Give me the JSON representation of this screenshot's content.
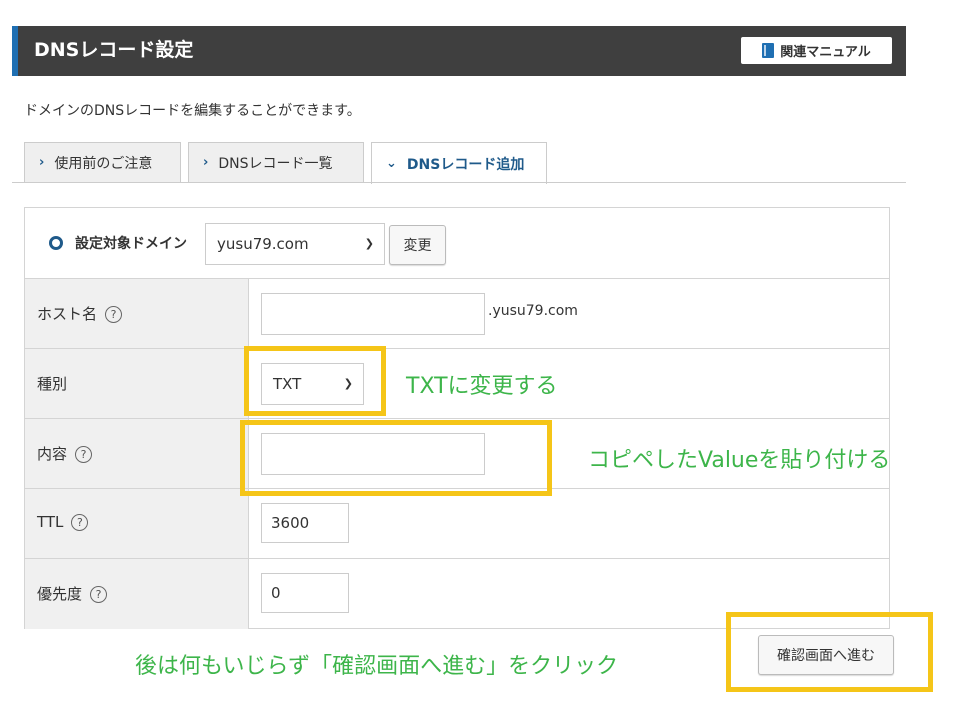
{
  "header": {
    "title": "DNSレコード設定",
    "manual_label": "関連マニュアル"
  },
  "description": "ドメインのDNSレコードを編集することができます。",
  "tabs": [
    {
      "label": "使用前のご注意",
      "chevron": "›",
      "active": false
    },
    {
      "label": "DNSレコード一覧",
      "chevron": "›",
      "active": false
    },
    {
      "label": "DNSレコード追加",
      "chevron": "⌄",
      "active": true
    }
  ],
  "domain": {
    "label": "設定対象ドメイン",
    "value": "yusu79.com",
    "change_label": "変更"
  },
  "form": {
    "host": {
      "label": "ホスト名",
      "value": "",
      "suffix": ".yusu79.com"
    },
    "type": {
      "label": "種別",
      "value": "TXT"
    },
    "content": {
      "label": "内容",
      "value": ""
    },
    "ttl": {
      "label": "TTL",
      "value": "3600"
    },
    "priority": {
      "label": "優先度",
      "value": "0"
    }
  },
  "help_glyph": "?",
  "submit_label": "確認画面へ進む",
  "annotations": {
    "type_note": "TXTに変更する",
    "content_note": "コピペしたValueを貼り付ける",
    "submit_note": "後は何もいじらず「確認画面へ進む」をクリック"
  },
  "colors": {
    "header_bg": "#3f3f3f",
    "accent": "#1f6fb2",
    "highlight": "#f5c518",
    "note_text": "#3db54a"
  }
}
